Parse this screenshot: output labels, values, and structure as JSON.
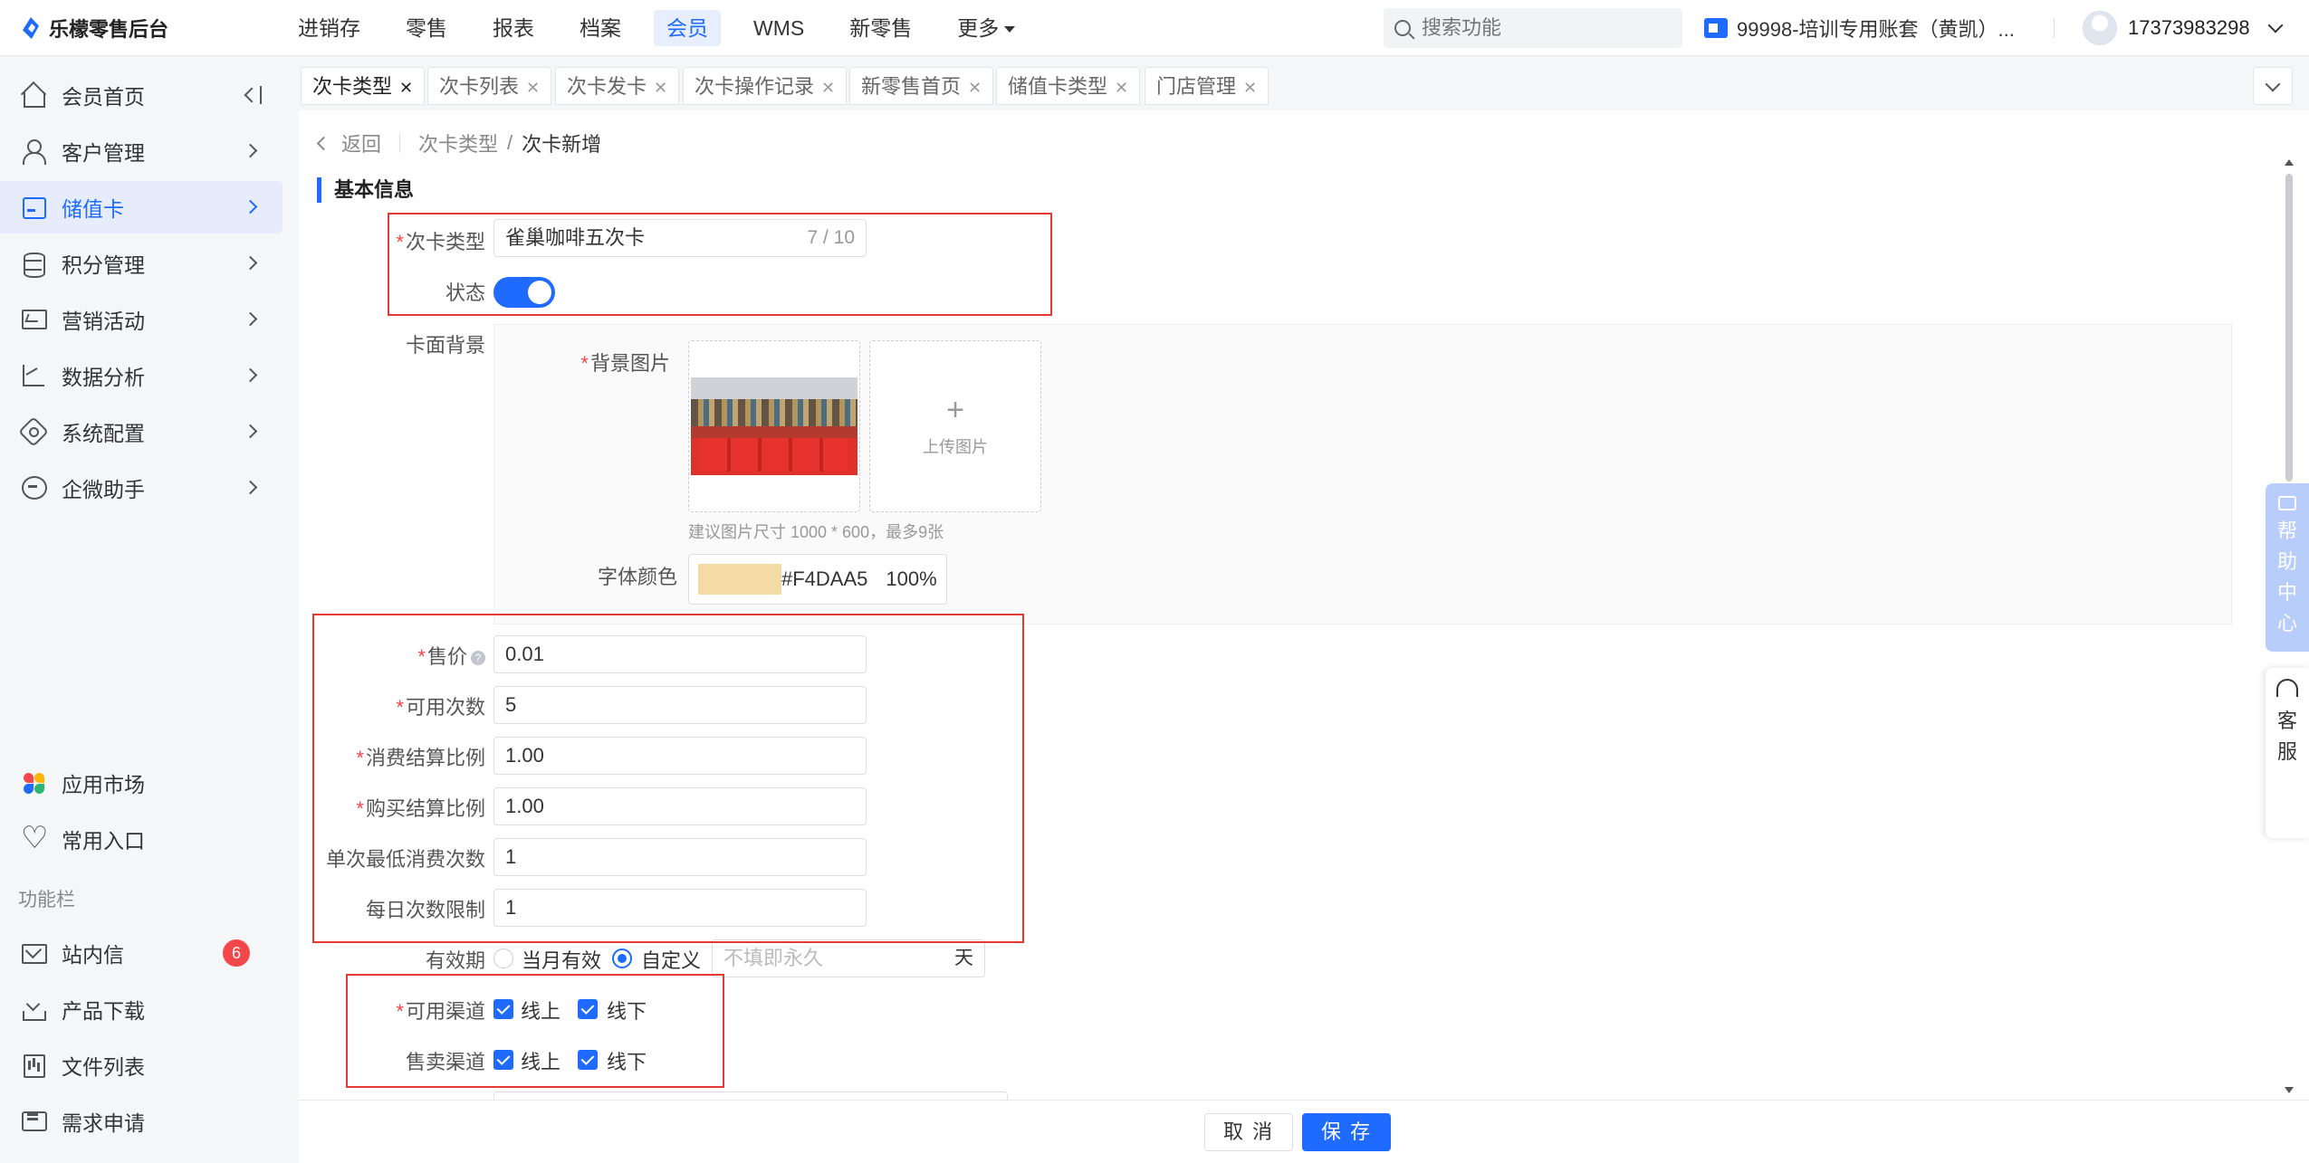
{
  "app": {
    "logo_text": "乐檬零售后台"
  },
  "topnav": {
    "items": [
      {
        "label": "进销存"
      },
      {
        "label": "零售"
      },
      {
        "label": "报表"
      },
      {
        "label": "档案"
      },
      {
        "label": "会员"
      },
      {
        "label": "WMS"
      },
      {
        "label": "新零售"
      },
      {
        "label": "更多"
      }
    ],
    "active": "会员",
    "search_placeholder": "搜索功能",
    "account": "99998-培训专用账套（黄凯）...",
    "user_phone": "17373983298"
  },
  "sidebar": {
    "items": [
      {
        "label": "会员首页"
      },
      {
        "label": "客户管理"
      },
      {
        "label": "储值卡"
      },
      {
        "label": "积分管理"
      },
      {
        "label": "营销活动"
      },
      {
        "label": "数据分析"
      },
      {
        "label": "系统配置"
      },
      {
        "label": "企微助手"
      }
    ],
    "bottom": [
      {
        "label": "应用市场"
      },
      {
        "label": "常用入口"
      }
    ],
    "section_label": "功能栏",
    "func": [
      {
        "label": "站内信",
        "badge": "6"
      },
      {
        "label": "产品下载"
      },
      {
        "label": "文件列表"
      },
      {
        "label": "需求申请"
      }
    ]
  },
  "tabs": [
    {
      "label": "次卡类型"
    },
    {
      "label": "次卡列表"
    },
    {
      "label": "次卡发卡"
    },
    {
      "label": "次卡操作记录"
    },
    {
      "label": "新零售首页"
    },
    {
      "label": "储值卡类型"
    },
    {
      "label": "门店管理"
    }
  ],
  "breadcrumb": {
    "back": "返回",
    "parent": "次卡类型",
    "current": "次卡新增"
  },
  "form": {
    "section_title": "基本信息",
    "card_type": {
      "label": "次卡类型",
      "value": "雀巢咖啡五次卡",
      "counter": "7 / 10"
    },
    "status": {
      "label": "状态",
      "on": true
    },
    "card_bg": {
      "label": "卡面背景",
      "image_label": "背景图片",
      "upload_label": "上传图片",
      "hint": "建议图片尺寸 1000 * 600，最多9张",
      "font_color_label": "字体颜色",
      "font_color_hex": "#F4DAA5",
      "font_color_opacity": "100%",
      "swatch_color": "#F4DAA5"
    },
    "price": {
      "label": "售价",
      "value": "0.01"
    },
    "times": {
      "label": "可用次数",
      "value": "5"
    },
    "consume_ratio": {
      "label": "消费结算比例",
      "value": "1.00"
    },
    "buy_ratio": {
      "label": "购买结算比例",
      "value": "1.00"
    },
    "min_times": {
      "label": "单次最低消费次数",
      "value": "1"
    },
    "daily_limit": {
      "label": "每日次数限制",
      "value": "1"
    },
    "validity": {
      "label": "有效期",
      "opt_month": "当月有效",
      "opt_custom": "自定义",
      "placeholder": "不填即永久",
      "unit": "天",
      "selected": "自定义"
    },
    "use_channel": {
      "label": "可用渠道",
      "online": "线上",
      "offline": "线下"
    },
    "sale_channel": {
      "label": "售卖渠道",
      "online": "线上",
      "offline": "线下"
    }
  },
  "float": {
    "help": [
      "帮",
      "助",
      "中",
      "心"
    ],
    "service": [
      "客",
      "服"
    ]
  },
  "footer": {
    "cancel": "取 消",
    "save": "保 存"
  },
  "colors": {
    "primary": "#1f6bff",
    "required": "#f5464a",
    "highlight_box": "#e53935"
  }
}
